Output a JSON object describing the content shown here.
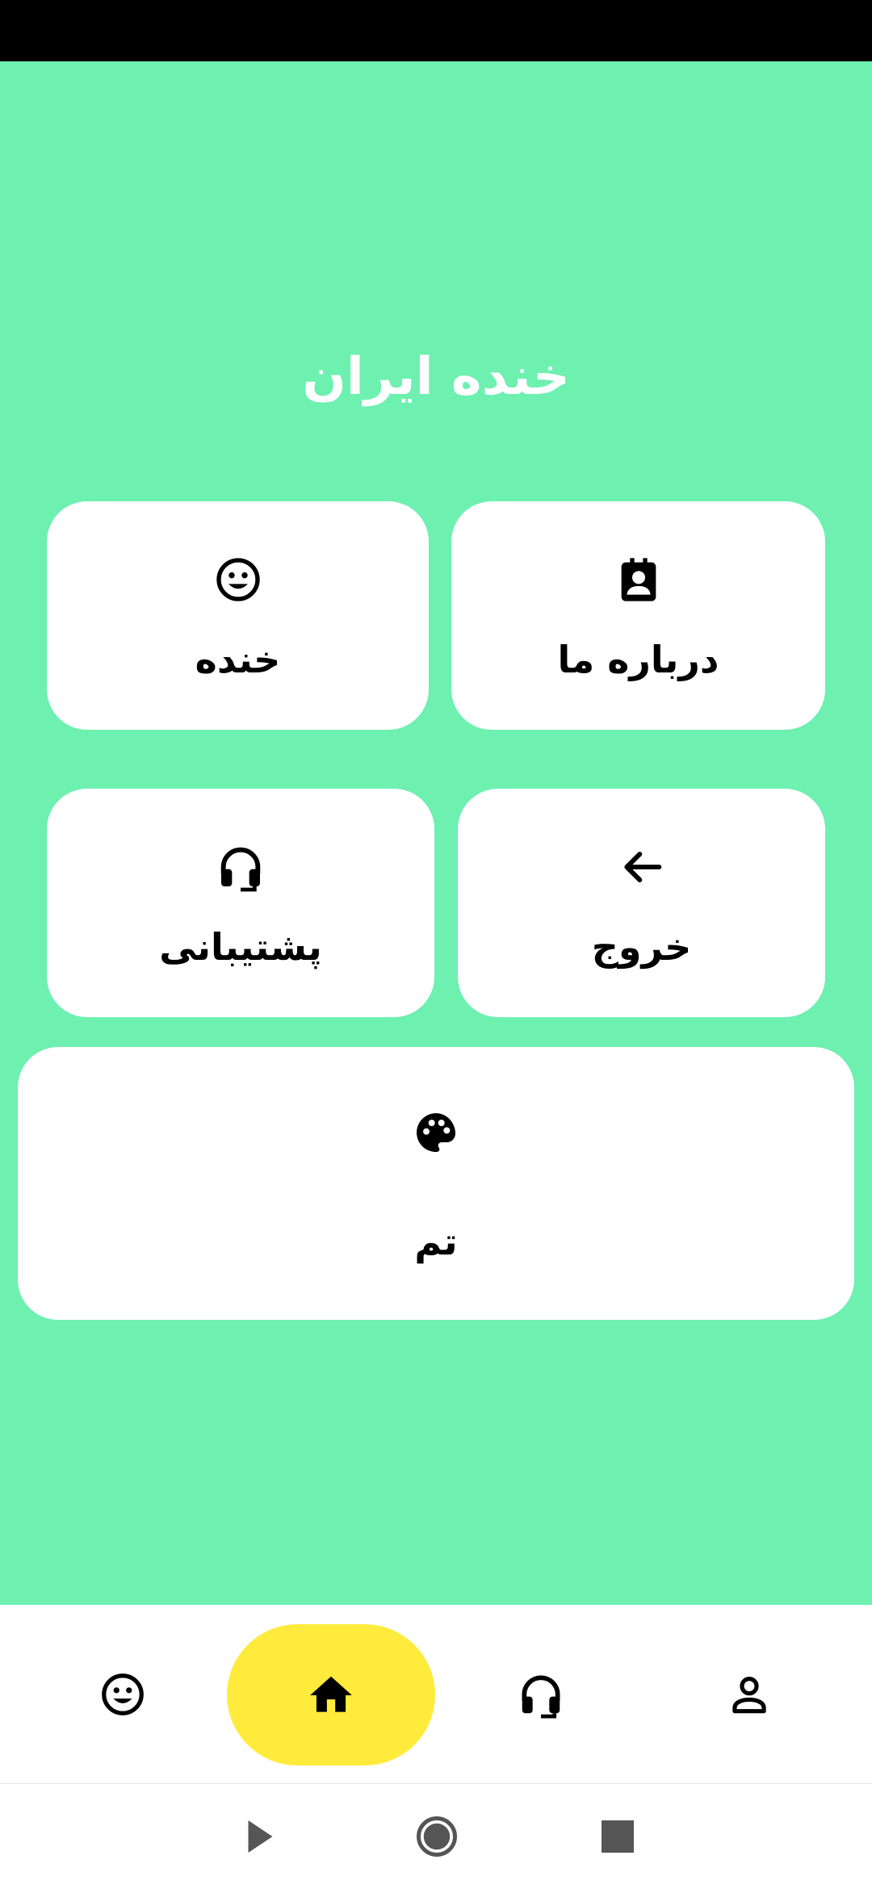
{
  "app": {
    "title": "خنده ایران"
  },
  "colors": {
    "background": "#6df0b0",
    "card": "#ffffff",
    "active_nav": "#ffeb3b",
    "title_text": "#ffffff"
  },
  "cards": {
    "laugh": {
      "label": "خنده",
      "icon": "smiley-icon"
    },
    "about": {
      "label": "درباره ما",
      "icon": "contact-card-icon"
    },
    "support": {
      "label": "پشتیبانی",
      "icon": "headset-icon"
    },
    "exit": {
      "label": "خروج",
      "icon": "arrow-left-icon"
    },
    "theme": {
      "label": "تم",
      "icon": "palette-icon"
    }
  },
  "bottom_nav": {
    "items": [
      {
        "icon": "smiley-icon",
        "active": false
      },
      {
        "icon": "home-icon",
        "active": true
      },
      {
        "icon": "headset-icon",
        "active": false
      },
      {
        "icon": "person-icon",
        "active": false
      }
    ]
  },
  "system_nav": {
    "items": [
      "back-triangle-icon",
      "home-circle-icon",
      "recents-square-icon"
    ]
  }
}
